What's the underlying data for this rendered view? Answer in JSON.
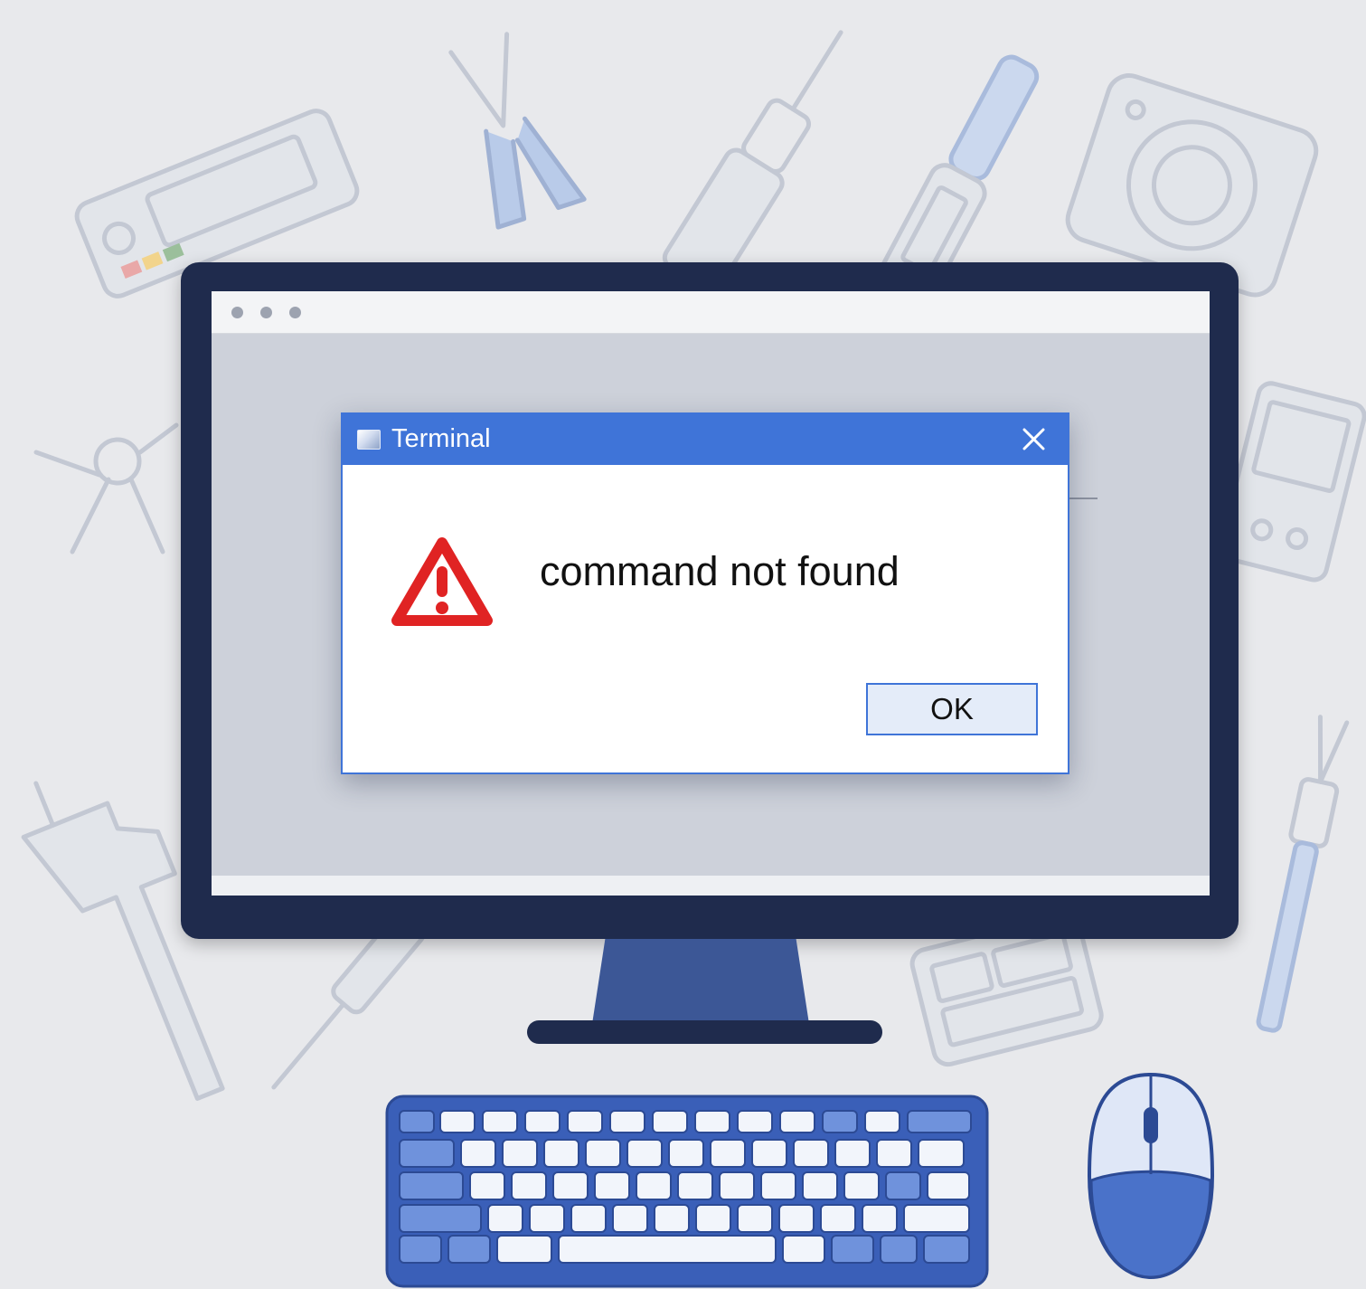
{
  "dialog": {
    "title": "Terminal",
    "message": "command not found",
    "ok_label": "OK"
  },
  "icons": {
    "app": "terminal-app-icon",
    "close": "close-icon",
    "warning": "warning-triangle-icon",
    "traffic": "window-dots-icon"
  },
  "colors": {
    "background": "#e8e9ec",
    "bezel": "#1f2b4d",
    "accent": "#3f74d8",
    "warning": "#e02323",
    "keyboard": "#4a72c9",
    "screen": "#cdd1da"
  }
}
